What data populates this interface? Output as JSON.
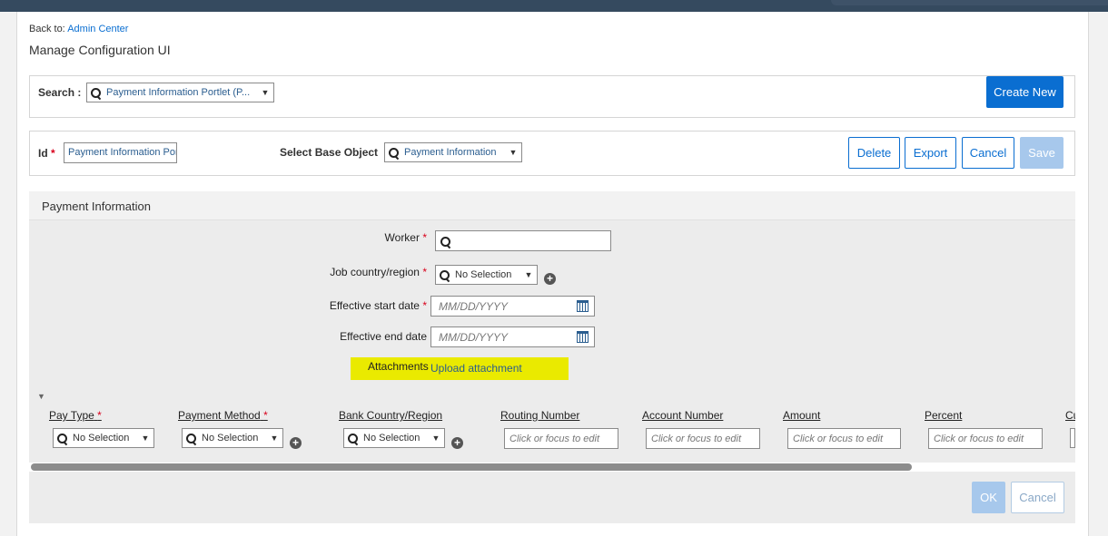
{
  "back_to": {
    "prefix": "Back to:",
    "link": "Admin Center"
  },
  "page_title": "Manage Configuration UI",
  "search": {
    "label": "Search :",
    "value": "Payment Information Portlet (P...",
    "icon": "search-icon"
  },
  "create_new_label": "Create New",
  "id_field": {
    "label": "Id",
    "value": "Payment Information Portlet"
  },
  "base_object": {
    "label": "Select Base Object",
    "value": "Payment Information"
  },
  "toolbar": {
    "delete": "Delete",
    "export": "Export",
    "cancel": "Cancel",
    "save": "Save"
  },
  "section_title": "Payment Information",
  "form": {
    "worker_label": "Worker",
    "job_country_label": "Job country/region",
    "job_country_value": "No Selection",
    "start_date_label": "Effective start date",
    "start_date_placeholder": "MM/DD/YYYY",
    "end_date_label": "Effective end date",
    "end_date_placeholder": "MM/DD/YYYY",
    "attachments_label": "Attachments",
    "upload_link": "Upload attachment"
  },
  "grid": {
    "columns": [
      "Pay Type",
      "Payment Method",
      "Bank Country/Region",
      "Routing Number",
      "Account Number",
      "Amount",
      "Percent",
      "Cu"
    ],
    "no_selection": "No Selection",
    "edit_placeholder": "Click or focus to edit"
  },
  "footer": {
    "ok": "OK",
    "cancel": "Cancel"
  },
  "colors": {
    "accent": "#0a6ed1",
    "required": "#d9001b",
    "highlight": "#eaea00"
  }
}
